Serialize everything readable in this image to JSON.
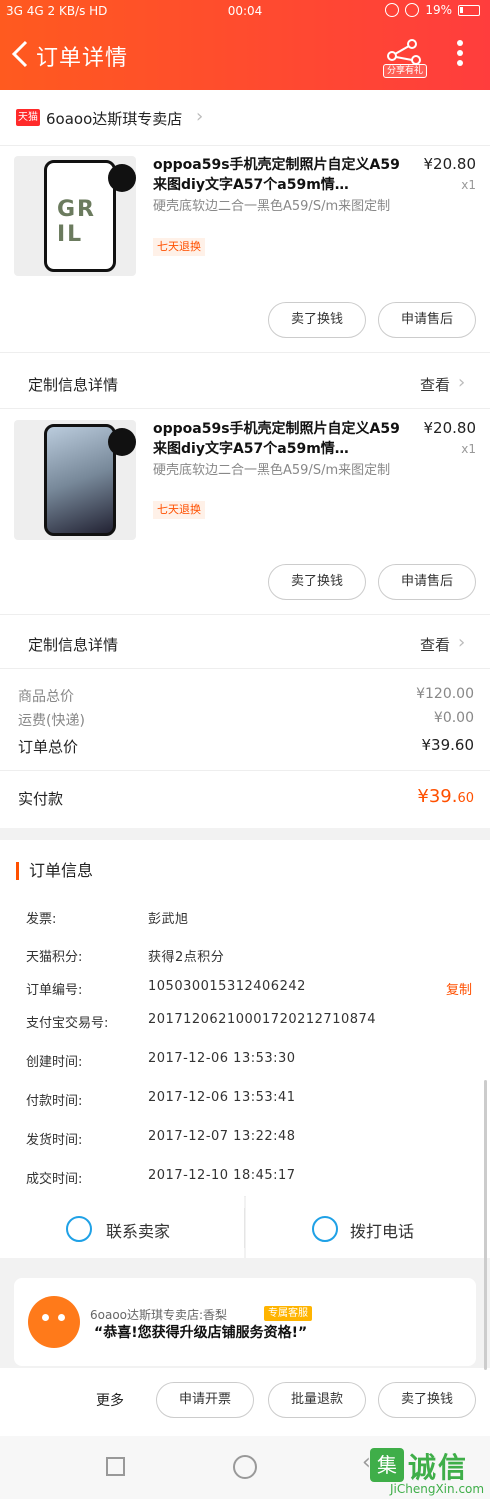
{
  "status_bar": {
    "left": "3G 4G 2 KB/s HD",
    "time": "00:04",
    "battery": "19%"
  },
  "header": {
    "title": "订单详情",
    "share_label": "分享有礼"
  },
  "store": {
    "badge": "天猫",
    "name": "6oaoo达斯琪专卖店"
  },
  "products": [
    {
      "title": "oppoa59s手机壳定制照片自定义A59来图diy文字A57个a59m情…",
      "spec": "硬壳底软边二合一黑色A59/S/m来图定制",
      "tag": "七天退换",
      "price": "¥20.80",
      "qty": "x1",
      "btn_left": "卖了换钱",
      "btn_right": "申请售后",
      "custom_label": "定制信息详情",
      "custom_action": "查看"
    },
    {
      "title": "oppoa59s手机壳定制照片自定义A59来图diy文字A57个a59m情…",
      "spec": "硬壳底软边二合一黑色A59/S/m来图定制",
      "tag": "七天退换",
      "price": "¥20.80",
      "qty": "x1",
      "btn_left": "卖了换钱",
      "btn_right": "申请售后",
      "custom_label": "定制信息详情",
      "custom_action": "查看"
    }
  ],
  "summary": {
    "goods_label": "商品总价",
    "goods_value": "¥120.00",
    "ship_label": "运费(快递)",
    "ship_value": "¥0.00",
    "total_label": "订单总价",
    "total_value": "¥39.60",
    "paid_label": "实付款",
    "paid_main": "¥39.",
    "paid_cents": "60"
  },
  "order_info": {
    "heading": "订单信息",
    "rows": [
      {
        "label": "发票:",
        "value": "彭武旭"
      },
      {
        "label": "天猫积分:",
        "value": "获得2点积分"
      },
      {
        "label": "订单编号:",
        "value": "105030015312406242"
      },
      {
        "label": "支付宝交易号:",
        "value": "20171206210001720212710874"
      },
      {
        "label": "创建时间:",
        "value": "2017-12-06 13:53:30"
      },
      {
        "label": "付款时间:",
        "value": "2017-12-06 13:53:41"
      },
      {
        "label": "发货时间:",
        "value": "2017-12-07 13:22:48"
      },
      {
        "label": "成交时间:",
        "value": "2017-12-10 18:45:17"
      }
    ],
    "copy": "复制"
  },
  "actions": {
    "contact": "联系卖家",
    "call": "拨打电话"
  },
  "message": {
    "name": "6oaoo达斯琪专卖店:香梨",
    "badge": "专属客服",
    "text": "“恭喜!您获得升级店铺服务资格!”"
  },
  "bottom": {
    "more": "更多",
    "invoice": "申请开票",
    "bulk_refund": "批量退款",
    "sell": "卖了换钱"
  },
  "watermark": {
    "logo": "集",
    "cn": "诚信",
    "en": "JiChengXin.com"
  },
  "colors": {
    "accent": "#ff5000",
    "header_start": "#ff5a1f",
    "header_end": "#ff3d3d",
    "blue_icon": "#1fa1e6"
  }
}
